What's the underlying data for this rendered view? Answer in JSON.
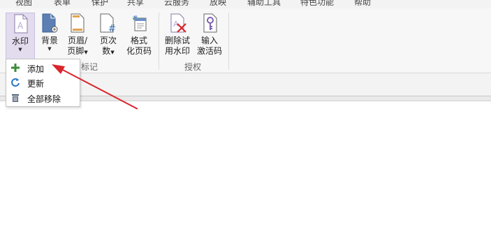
{
  "menu": {
    "tabs": [
      "视图",
      "表单",
      "保护",
      "共享",
      "云服务",
      "放映",
      "辅助工具",
      "特色功能",
      "帮助"
    ]
  },
  "ribbon": {
    "tools": {
      "watermark": {
        "line1": "水印"
      },
      "background": {
        "line1": "背景"
      },
      "header_footer": {
        "line1": "页眉/",
        "line2": "页脚"
      },
      "page_number": {
        "line1": "页次",
        "line2": "数"
      },
      "format_page_code": {
        "line1": "格式",
        "line2": "化页码"
      },
      "delete_trial_watermark": {
        "line1": "删除试",
        "line2": "用水印"
      },
      "enter_activation_code": {
        "line1": "输入",
        "line2": "激活码"
      }
    },
    "groups": {
      "mark": "标记",
      "authorize": "授权"
    }
  },
  "dropdown": {
    "items": [
      {
        "label": "添加",
        "icon": "plus-icon"
      },
      {
        "label": "更新",
        "icon": "refresh-icon"
      },
      {
        "label": "全部移除",
        "icon": "trash-icon"
      }
    ]
  },
  "colors": {
    "accent": "#7f62b0",
    "annotation_arrow": "#d9262c",
    "plus_icon": "#3a8c3a",
    "refresh_icon": "#2a76c6"
  }
}
